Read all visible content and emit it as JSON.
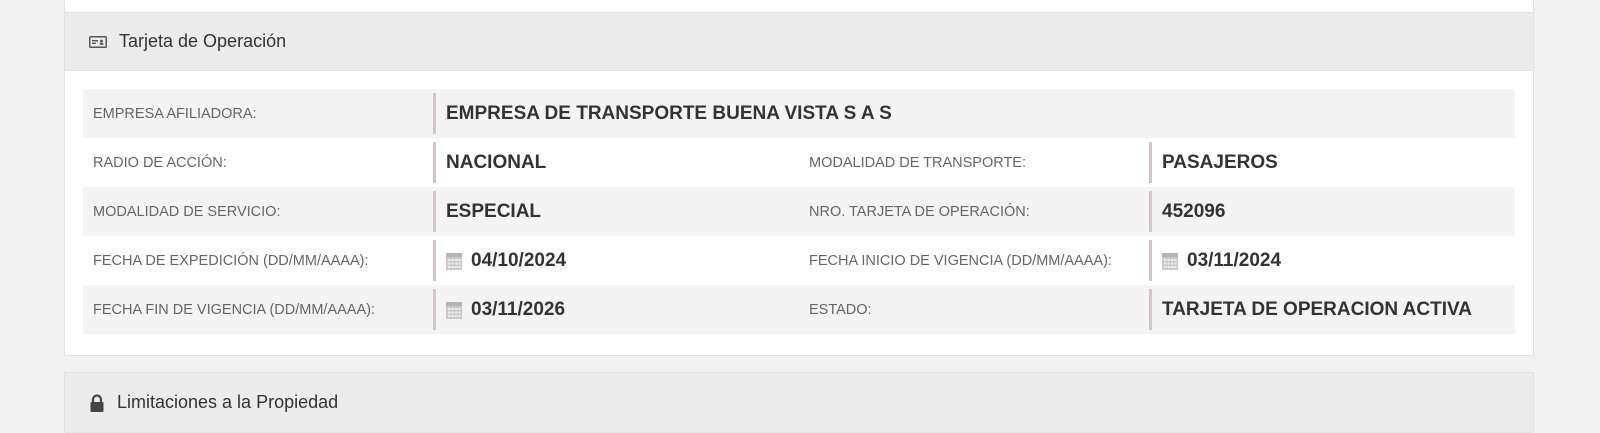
{
  "operation_card": {
    "title": "Tarjeta de Operación",
    "icon": "id-card-icon",
    "rows": [
      {
        "label1": "EMPRESA AFILIADORA:",
        "value1": "EMPRESA DE TRANSPORTE BUENA VISTA S A S"
      },
      {
        "label1": "RADIO DE ACCIÓN:",
        "value1": "NACIONAL",
        "label2": "MODALIDAD DE TRANSPORTE:",
        "value2": "PASAJEROS"
      },
      {
        "label1": "MODALIDAD DE SERVICIO:",
        "value1": "ESPECIAL",
        "label2": "NRO. TARJETA DE OPERACIÓN:",
        "value2": "452096"
      },
      {
        "label1": "FECHA DE EXPEDICIÓN (DD/MM/AAAA):",
        "value1": "04/10/2024",
        "label2": "FECHA INICIO DE VIGENCIA (DD/MM/AAAA):",
        "value2": "03/11/2024"
      },
      {
        "label1": "FECHA FIN DE VIGENCIA (DD/MM/AAAA):",
        "value1": "03/11/2026",
        "label2": "ESTADO:",
        "value2": "TARJETA DE OPERACION ACTIVA"
      }
    ]
  },
  "limitations": {
    "title": "Limitaciones a la Propiedad",
    "icon": "lock-icon"
  },
  "colors": {
    "page_bg": "#f1f1f1",
    "heading_bg": "#ececec",
    "row_shade": "#f4f4f4",
    "value_border": "#d9c3c5"
  }
}
